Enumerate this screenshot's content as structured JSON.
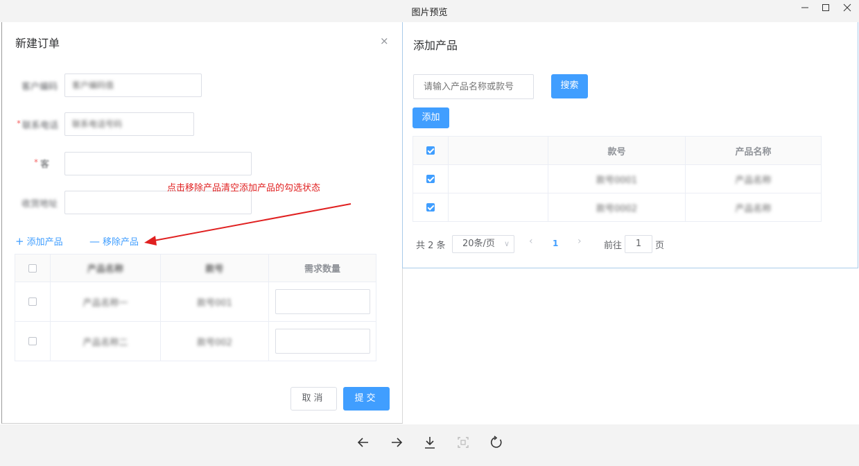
{
  "window": {
    "title": "图片预览",
    "minimize": "—",
    "maximize": "☐",
    "close": "✕"
  },
  "new_order": {
    "title": "新建订单",
    "close": "×",
    "fields": [
      {
        "label": "客户编码",
        "value": "客户编码值",
        "required": false
      },
      {
        "label": "联系电话",
        "value": "联系电话号码",
        "required": true
      },
      {
        "label": "客户",
        "value": "",
        "required": true
      },
      {
        "label": "收货地址",
        "value": "",
        "required": false
      }
    ],
    "req_mark": "*",
    "field3_label_tail": "客",
    "field4_label_tail": "址",
    "annotation": "点击移除产品清空添加产品的勾选状态",
    "add_product": "添加产品",
    "remove_product": "移除产品",
    "table": {
      "headers": [
        "产品名称",
        "款号",
        "需求数量"
      ],
      "rows": [
        {
          "name": "产品名称一",
          "code": "款号001"
        },
        {
          "name": "产品名称二",
          "code": "款号002"
        }
      ]
    },
    "cancel": "取消",
    "submit": "提交"
  },
  "add_product_dialog": {
    "title": "添加产品",
    "search_placeholder": "请输入产品名称或款号",
    "search_button": "搜索",
    "add_button": "添加",
    "table": {
      "headers": [
        "",
        "款号",
        "产品名称"
      ],
      "rows": [
        {
          "code": "款号0001",
          "name": "产品名称"
        },
        {
          "code": "款号0002",
          "name": "产品名称"
        }
      ]
    },
    "pager": {
      "total": "共 2 条",
      "page_size": "20条/页",
      "current_page": "1",
      "goto_prefix": "前往",
      "goto_value": "1",
      "goto_suffix": "页"
    }
  },
  "toolbar": [
    "arrow-left",
    "arrow-right",
    "download",
    "fit-screen",
    "rotate"
  ]
}
